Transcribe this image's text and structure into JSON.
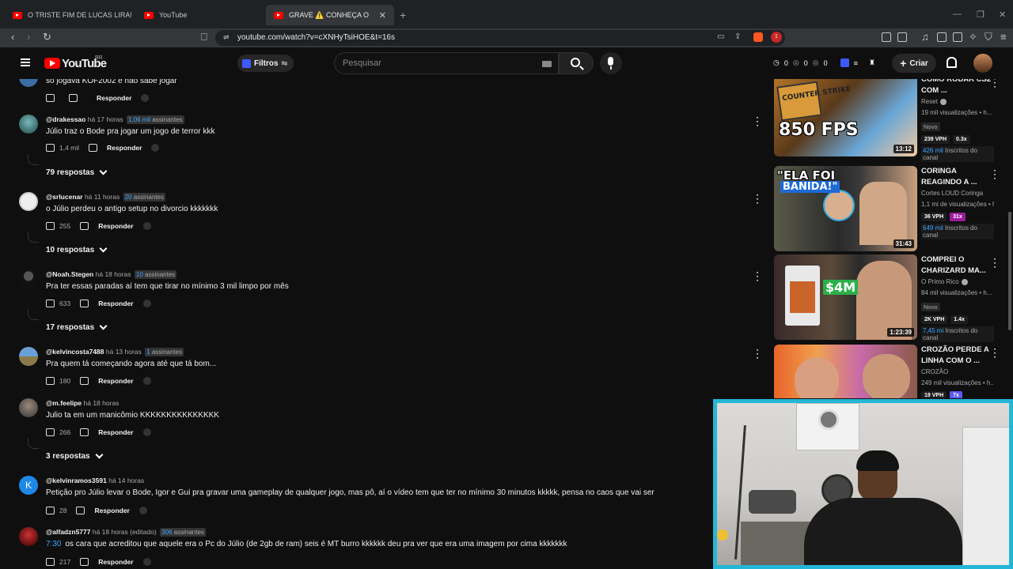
{
  "browser": {
    "tabs": [
      {
        "label": "O TRISTE FIM DE LUCAS LIRA! - YouT"
      },
      {
        "label": "YouTube"
      },
      {
        "label": "GRAVE ⚠️ CONHEÇA O CATIVEI"
      }
    ],
    "url": "youtube.com/watch?v=cXNHyTsiHOE&t=16s",
    "extension_badge": "1"
  },
  "youtube": {
    "logo_text": "YouTube",
    "country": "BR",
    "filters_label": "Filtros",
    "search_placeholder": "Pesquisar",
    "stats": [
      "0",
      "0",
      "0"
    ],
    "create_label": "Criar"
  },
  "comments": [
    {
      "text": "so jogava KOF2002 e não sabe jogar",
      "likes": "",
      "reply": "Responder"
    },
    {
      "user": "@drakessao",
      "time": "há 17 horas",
      "subs_n": "1,06 mil",
      "subs_label": "assinantes",
      "text": "Júlio traz o Bode pra jogar um jogo de terror kkk",
      "likes": "1,4 mil",
      "reply": "Responder",
      "replies": "79 respostas"
    },
    {
      "user": "@srlucenar",
      "time": "há 11 horas",
      "subs_n": "20",
      "subs_label": "assinantes",
      "text": "o Júlio perdeu o antigo setup no divorcio kkkkkkk",
      "likes": "255",
      "reply": "Responder",
      "replies": "10 respostas"
    },
    {
      "user": "@Noah.Stegen",
      "time": "há 18 horas",
      "subs_n": "10",
      "subs_label": "assinantes",
      "text": "Pra ter essas paradas aí tem que tirar no mínimo 3 mil limpo por mês",
      "likes": "633",
      "reply": "Responder",
      "replies": "17 respostas"
    },
    {
      "user": "@kelvincosta7488",
      "time": "há 13 horas",
      "subs_n": "1",
      "subs_label": "assinantes",
      "text": "Pra quem tá começando agora até que tá bom...",
      "likes": "180",
      "reply": "Responder"
    },
    {
      "user": "@m.feelipe",
      "time": "há 18 horas",
      "text": "Julio ta em um manicômio KKKKKKKKKKKKKKK",
      "likes": "266",
      "reply": "Responder",
      "replies": "3 respostas"
    },
    {
      "user": "@kelvinramos3591",
      "time": "há 14 horas",
      "avatar_letter": "K",
      "text": "Petição pro Júlio levar o Bode, Igor e Gui pra gravar uma gameplay de qualquer jogo, mas pô, aí o vídeo tem que ter no mínimo 30 minutos kkkkk, pensa no caos que vai ser",
      "likes": "28",
      "reply": "Responder"
    },
    {
      "user": "@alfadzn5777",
      "time": "há 18 horas (editado)",
      "subs_n": "306",
      "subs_label": "assinantes",
      "timestamp_link": "7:30",
      "text": "os cara que acreditou que aquele era o Pc do Júlio (de 2gb de ram) seis é MT burro kkkkkk deu pra ver que era uma imagem por cima kkkkkkk",
      "likes": "217",
      "reply": "Responder"
    }
  ],
  "sidebar": [
    {
      "title": "COMO RODAR CS2 COM ...",
      "channel": "Reset",
      "views": "19 mil visualizações • h...",
      "badge": "Novo",
      "vph": "239 VPH",
      "mult": "0.3x",
      "subs_n": "426 mil",
      "subs_label": "Inscritos do canal",
      "duration": "13:12",
      "thumb_text": "850 FPS",
      "thumb_text2": "COUNTER STRIKE"
    },
    {
      "title": "CORINGA REAGINDO A ...",
      "channel": "Cortes LOUD Coringa",
      "views": "1,1 mi de visualizações • h...",
      "vph": "36 VPH",
      "mult": "31x",
      "subs_n": "649 mil",
      "subs_label": "Inscritos do canal",
      "duration": "31:43",
      "thumb_text": "\"ELA FOI",
      "thumb_text2": "BANIDA!\""
    },
    {
      "title": "COMPREI O CHARIZARD MA...",
      "channel": "O Primo Rico",
      "views": "84 mil visualizações • h...",
      "badge": "Novo",
      "vph": "2K VPH",
      "mult": "1.4x",
      "subs_n": "7,45 mi",
      "subs_label": "Inscritos do canal",
      "duration": "1:23:39",
      "thumb_text": "$4M"
    },
    {
      "title": "CROZÃO PERDE A LINHA COM O ...",
      "channel": "CROZÃO",
      "views": "249 mil visualizações • h...",
      "vph": "19 VPH",
      "mult": "7x"
    }
  ]
}
